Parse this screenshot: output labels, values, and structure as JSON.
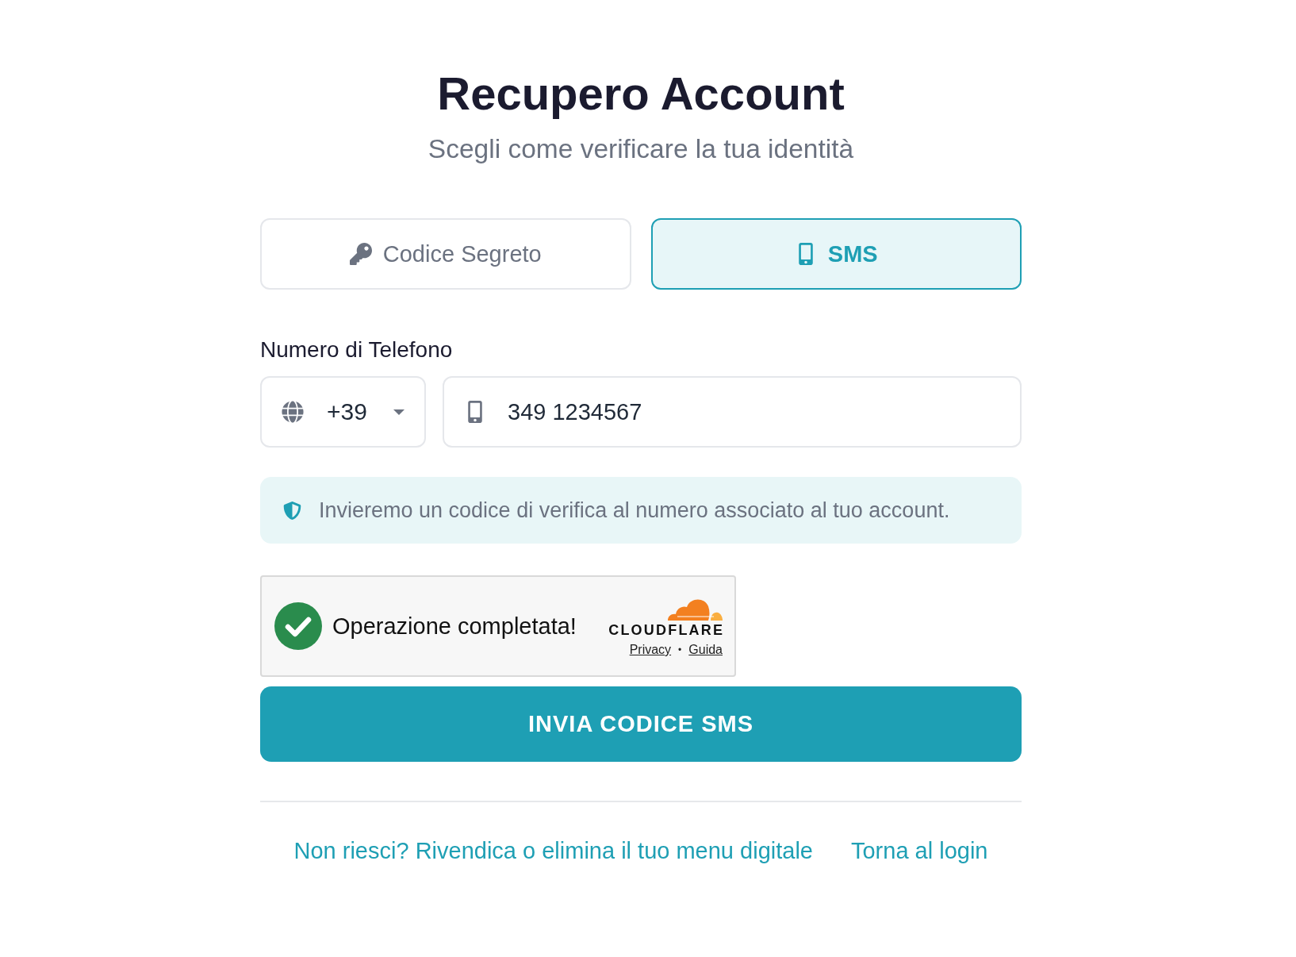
{
  "header": {
    "title": "Recupero Account",
    "subtitle": "Scegli come verificare la tua identità"
  },
  "tabs": [
    {
      "kind": "secret_code",
      "label": "Codice Segreto",
      "selected": false
    },
    {
      "kind": "sms",
      "label": "SMS",
      "selected": true
    }
  ],
  "phone": {
    "label": "Numero di Telefono",
    "country_code": "+39",
    "number": "349 1234567"
  },
  "notice": {
    "text": "Invieremo un codice di verifica al numero associato al tuo account."
  },
  "captcha": {
    "verified": true,
    "status": "Operazione completata!",
    "brand": "CLOUDFLARE",
    "links": [
      "Privacy",
      "Guida"
    ],
    "separator": "•"
  },
  "submit_button": {
    "label": "INVIA CODICE SMS"
  },
  "footer_links": [
    "Non riesci? Rivendica o elimina il tuo menu digitale",
    "Torna al login"
  ]
}
